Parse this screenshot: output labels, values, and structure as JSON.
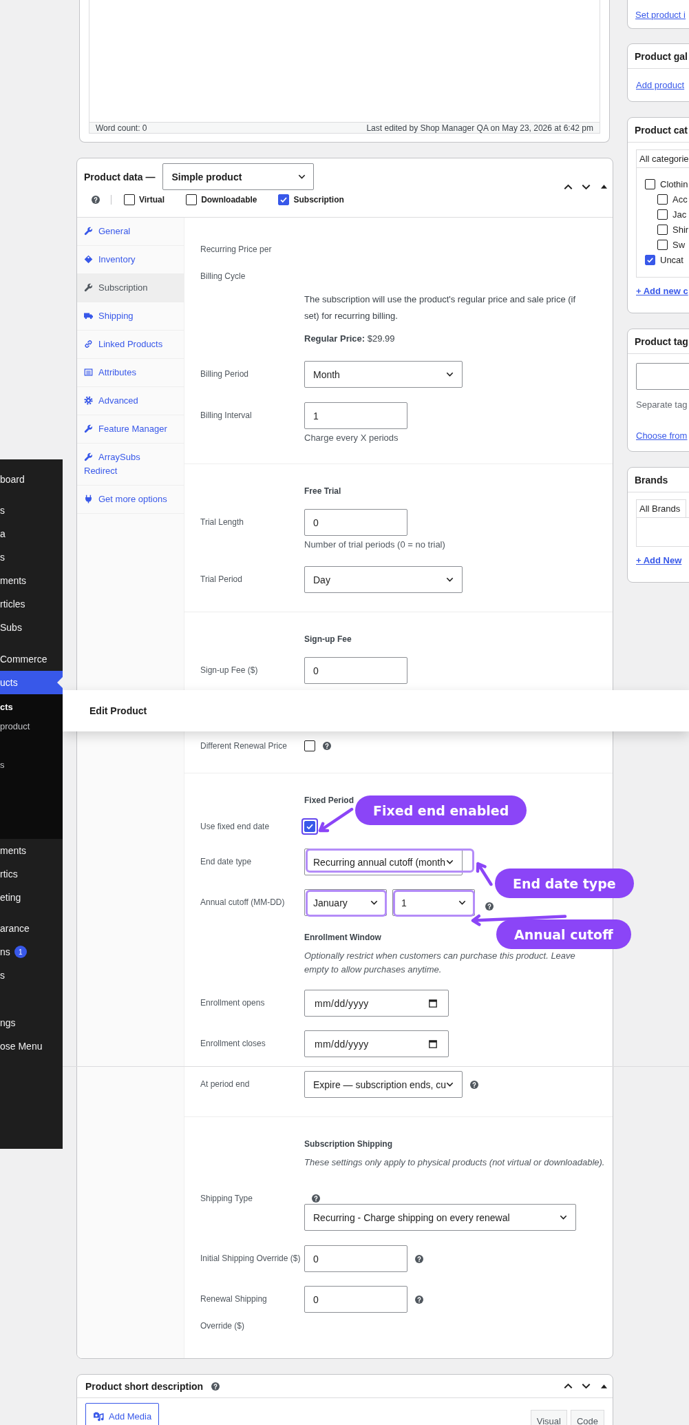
{
  "editor": {
    "word_count": "Word count: 0",
    "last_edited": "Last edited by Shop Manager QA on May 23, 2026 at 6:42 pm"
  },
  "product_data": {
    "title": "Product data —",
    "product_type": "Simple product",
    "options": [
      {
        "label": "Virtual",
        "checked": false
      },
      {
        "label": "Downloadable",
        "checked": false
      },
      {
        "label": "Subscription",
        "checked": true
      }
    ],
    "tabs": [
      {
        "label": "General",
        "selected": false
      },
      {
        "label": "Inventory",
        "selected": false
      },
      {
        "label": "Subscription",
        "selected": true
      },
      {
        "label": "Shipping",
        "selected": false
      },
      {
        "label": "Linked Products",
        "selected": false
      },
      {
        "label": "Attributes",
        "selected": false
      },
      {
        "label": "Advanced",
        "selected": false
      },
      {
        "label": "Feature Manager",
        "selected": false
      },
      {
        "label": "ArraySubs Redirect",
        "selected": false
      },
      {
        "label": "Get more options",
        "selected": false
      }
    ],
    "groups": [
      {
        "items": [
          {
            "kind": "label",
            "label": "Recurring Price per\nBilling Cycle"
          },
          {
            "kind": "note",
            "text": "The subscription will use the product's regular price and sale price (if set) for recurring billing."
          },
          {
            "kind": "note",
            "text": "**Regular Price:** $29.99"
          },
          {
            "kind": "select",
            "label": "Billing Period",
            "value": "Month"
          },
          {
            "kind": "input",
            "label": "Billing Interval",
            "value": "1",
            "description": "Charge every X periods"
          }
        ]
      },
      {
        "items": [
          {
            "kind": "heading",
            "text": "Free Trial"
          },
          {
            "kind": "input",
            "label": "Trial Length",
            "value": "0",
            "description": "Number of trial periods (0 = no trial)"
          },
          {
            "kind": "select",
            "label": "Trial Period",
            "value": "Day"
          }
        ]
      },
      {
        "items": [
          {
            "kind": "heading",
            "text": "Sign-up Fee"
          },
          {
            "kind": "input",
            "label": "Sign-up Fee ($)",
            "value": "0"
          },
          {
            "kind": "checkbox",
            "label": "Different Renewal Price",
            "checked": false,
            "help": true
          }
        ]
      },
      {
        "items": [
          {
            "kind": "heading",
            "text": "Fixed Period"
          },
          {
            "kind": "checkbox",
            "label": "Use fixed end date",
            "checked": true,
            "callout": "Fixed end enabled"
          },
          {
            "kind": "select",
            "label": "End date type",
            "value": "Recurring annual cutoff (month",
            "callout": "End date type"
          },
          {
            "kind": "pair",
            "label": "Annual cutoff (MM-DD)",
            "values": [
              "January",
              "1"
            ],
            "help": true,
            "callout": "Annual cutoff"
          },
          {
            "kind": "heading",
            "text": "Enrollment Window"
          },
          {
            "kind": "remark",
            "text": "Optionally restrict when customers can purchase this product. Leave\nempty to allow purchases anytime."
          },
          {
            "kind": "date",
            "label": "Enrollment opens",
            "placeholder": "mm/dd/yyyy"
          },
          {
            "kind": "date",
            "label": "Enrollment closes",
            "placeholder": "mm/dd/yyyy"
          },
          {
            "kind": "select",
            "label": "At period end",
            "value": "Expire — subscription ends, cu",
            "help": true
          }
        ]
      },
      {
        "items": [
          {
            "kind": "heading",
            "text": "Subscription Shipping"
          },
          {
            "kind": "remark",
            "text": "These settings only apply to physical products (not virtual or downloadable)."
          },
          {
            "kind": "select",
            "label": "Shipping Type",
            "value": "Recurring - Charge shipping on every renewal",
            "help": true,
            "help_above": true
          },
          {
            "kind": "input",
            "label": "Initial Shipping Override ($)",
            "value": "0",
            "help": true
          },
          {
            "kind": "input",
            "label": "Renewal Shipping\nOverride ($)",
            "value": "0",
            "help": true
          }
        ]
      }
    ]
  },
  "short_description": {
    "title": "Product short description",
    "button": "Add Media",
    "editor_tabs": [
      "Visual",
      "Code"
    ]
  },
  "sidebar": {
    "boxes": [
      {
        "kind": "link",
        "link": "Set product i"
      },
      {
        "kind": "link",
        "title": "Product gal",
        "link": "Add product"
      },
      {
        "kind": "checklist",
        "title": "Product cat",
        "tab": "All categorie",
        "categories": [
          {
            "label": "Clothin",
            "checked": false,
            "children": [
              {
                "label": "Acc",
                "checked": false
              },
              {
                "label": "Jac",
                "checked": false
              },
              {
                "label": "Shir",
                "checked": false
              },
              {
                "label": "Sw",
                "checked": false
              }
            ]
          },
          {
            "label": "Uncat",
            "checked": true
          }
        ],
        "link": "+ Add new c"
      },
      {
        "kind": "tags",
        "title": "Product tag",
        "note": "Separate tag",
        "link": "Choose from"
      },
      {
        "kind": "checklist",
        "title": "Brands",
        "tab": "All Brands",
        "link": "+ Add New"
      }
    ]
  },
  "admin_menu": {
    "items": [
      {
        "label": "board",
        "selected": false
      },
      {
        "label": "s",
        "selected": false
      },
      {
        "label": "a",
        "selected": false
      },
      {
        "label": "s",
        "selected": false
      },
      {
        "label": "ments",
        "selected": false
      },
      {
        "label": "rticles",
        "selected": false
      },
      {
        "label": "Subs",
        "selected": false
      },
      {
        "label": "Commerce",
        "selected": false
      },
      {
        "label": "ucts",
        "selected": true,
        "children": [
          {
            "label": "cts",
            "selected": true
          },
          {
            "label": "product",
            "selected": false
          },
          {
            "label": "s",
            "selected": false
          }
        ]
      },
      {
        "label": "ments",
        "selected": false
      },
      {
        "label": "rtics",
        "selected": false
      },
      {
        "label": "eting",
        "selected": false
      },
      {
        "label": "arance",
        "selected": false
      },
      {
        "label": "ns",
        "selected": false,
        "badge": "1"
      },
      {
        "label": "s",
        "selected": false
      },
      {
        "label": "ngs",
        "selected": false
      },
      {
        "label": "ose Menu",
        "selected": false
      }
    ]
  },
  "header_bar": {
    "title": "Edit Product"
  }
}
